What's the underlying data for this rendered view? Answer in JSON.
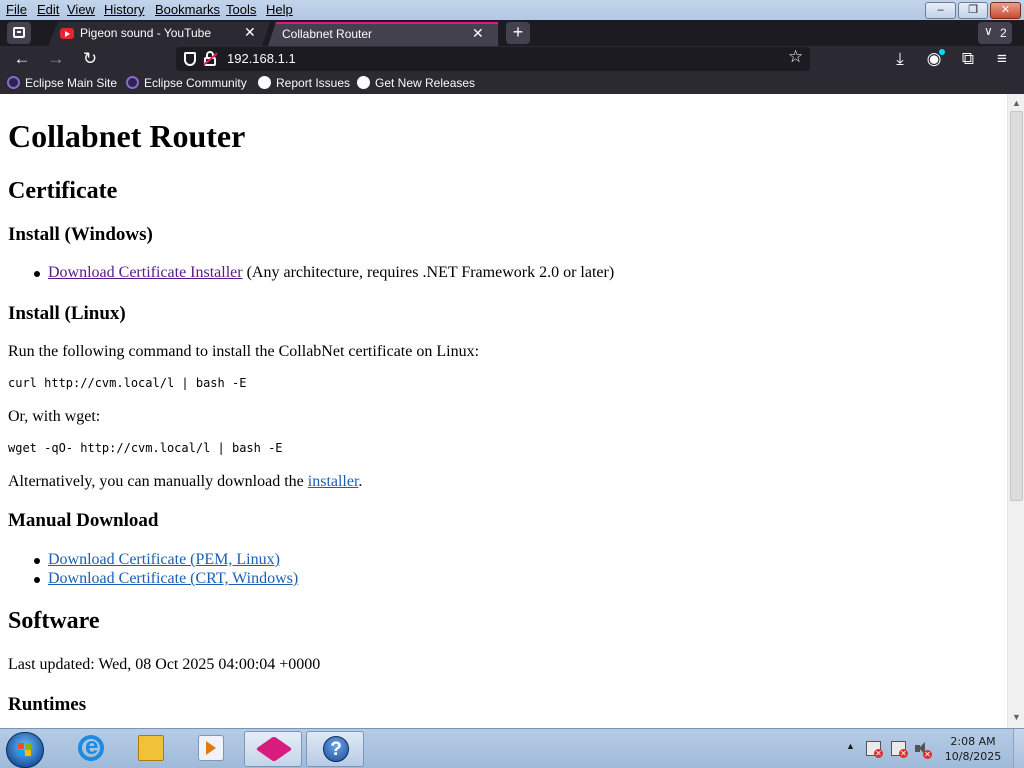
{
  "menubar": {
    "items": [
      {
        "label": "File"
      },
      {
        "label": "Edit"
      },
      {
        "label": "View"
      },
      {
        "label": "History"
      },
      {
        "label": "Bookmarks"
      },
      {
        "label": "Tools"
      },
      {
        "label": "Help"
      }
    ]
  },
  "tabs": [
    {
      "title": "Pigeon sound - YouTube",
      "icon": "youtube-icon",
      "active": false
    },
    {
      "title": "Collabnet Router",
      "icon": null,
      "active": true
    }
  ],
  "tab_list": {
    "count": "2"
  },
  "navbar": {
    "url": "192.168.1.1"
  },
  "bookmarks": [
    {
      "label": "Eclipse Main Site",
      "icon": "eclipse-icon"
    },
    {
      "label": "Eclipse Community",
      "icon": "eclipse-icon"
    },
    {
      "label": "Report Issues",
      "icon": "github-icon"
    },
    {
      "label": "Get New Releases",
      "icon": "github-icon"
    }
  ],
  "page": {
    "title": "Collabnet Router",
    "certificate": {
      "heading": "Certificate",
      "install_windows": {
        "heading": "Install (Windows)",
        "installer_link": "Download Certificate Installer",
        "installer_note": " (Any architecture, requires .NET Framework 2.0 or later)"
      },
      "install_linux": {
        "heading": "Install (Linux)",
        "run_command": "Run the following command to install the CollabNet certificate on Linux:",
        "curl_command": "curl http://cvm.local/l | bash -E",
        "or_wget": "Or, with wget:",
        "wget_command": "wget -qO- http://cvm.local/l | bash -E",
        "alternatively_prefix": "Alternatively, you can manually download the ",
        "installer_link": "installer",
        "alternatively_suffix": "."
      },
      "manual_download": {
        "heading": "Manual Download",
        "links": [
          "Download Certificate (PEM, Linux)",
          "Download Certificate (CRT, Windows)"
        ]
      }
    },
    "software": {
      "heading": "Software",
      "last_updated": "Last updated: Wed, 08 Oct 2025 04:00:04 +0000",
      "runtimes_heading": "Runtimes"
    }
  },
  "taskbar": {
    "pinned": [
      {
        "name": "internet-explorer"
      },
      {
        "name": "windows-explorer"
      },
      {
        "name": "media-player"
      },
      {
        "name": "eclipse"
      },
      {
        "name": "help-and-support"
      }
    ],
    "clock": {
      "time": "2:08 AM",
      "date": "10/8/2025"
    }
  },
  "colors": {
    "tab_accent": "#e31587",
    "link_visited": "#551a8b",
    "link": "#1a5fb4",
    "browser_dark": "#2b2a33"
  }
}
